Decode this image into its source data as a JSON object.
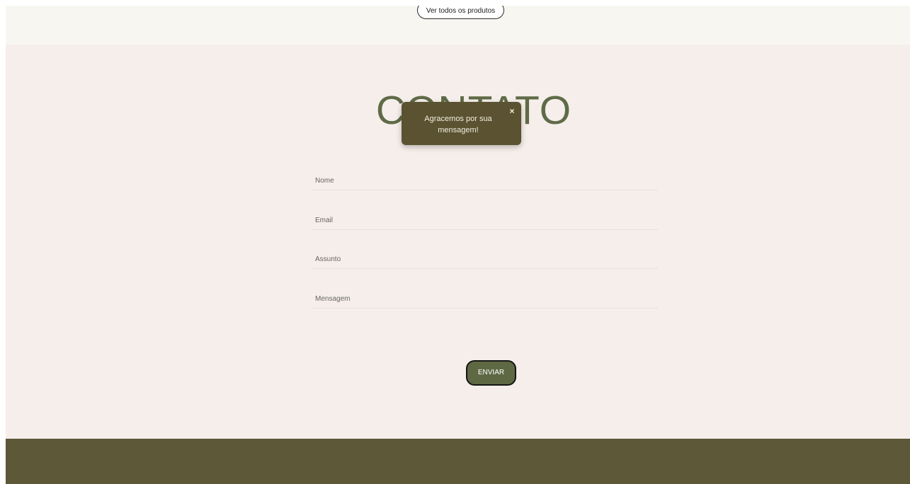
{
  "products": {
    "view_all_label": "Ver todos os produtos"
  },
  "contact": {
    "title": "CONTATO",
    "fields": {
      "name_label": "Nome",
      "email_label": "Email",
      "subject_label": "Assunto",
      "message_label": "Mensagem"
    },
    "submit_label": "ENVIAR"
  },
  "toast": {
    "message": "Agracemos por sua mensagem!",
    "close_glyph": "×"
  },
  "colors": {
    "accent_green": "#5f6b47",
    "toast_bg": "#5a5230",
    "footer_bg": "#5c5838",
    "section_bg": "#f5eeea"
  }
}
